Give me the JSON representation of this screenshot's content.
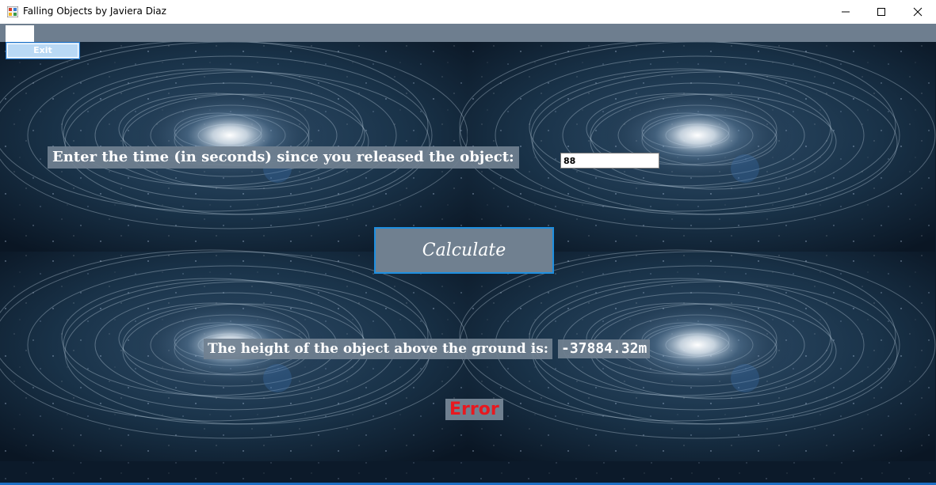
{
  "window": {
    "title": "Falling Objects by Javiera Diaz",
    "minimize_glyph": "—",
    "maximize_glyph": "☐",
    "close_glyph": "✕"
  },
  "menu": {
    "exit_label": "Exit"
  },
  "form": {
    "prompt_label": "Enter the time (in seconds) since you released the object:",
    "time_value": "88",
    "calculate_label": "Calculate",
    "result_label": "The height of the object above the ground is:",
    "result_value": "-37884.32m",
    "error_label": "Error"
  },
  "colors": {
    "label_background": "#708090",
    "error_text": "#e8181f",
    "button_border": "#1e8fe0",
    "menustrip": "#6e7e8f"
  },
  "icons": {
    "app": "app-icon",
    "minimize": "minimize-icon",
    "maximize": "maximize-icon",
    "close": "close-icon"
  }
}
